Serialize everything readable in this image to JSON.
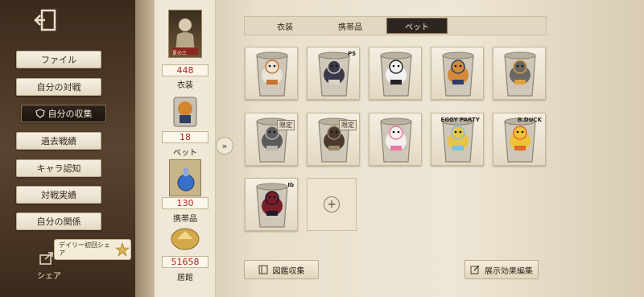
{
  "sidebar": {
    "items": [
      {
        "label": "ファイル"
      },
      {
        "label": "自分の対戦"
      },
      {
        "label": "自分の収集"
      },
      {
        "label": "過去戦績"
      },
      {
        "label": "キャラ認知"
      },
      {
        "label": "対戦実績"
      },
      {
        "label": "自分の関係"
      }
    ],
    "share_banner": "デイリー初回シェア",
    "share_label": "シェア"
  },
  "stats": {
    "costume": {
      "value": "448",
      "label": "衣装",
      "thumb_text": "夏の三"
    },
    "pet": {
      "value": "18",
      "label": "ペット"
    },
    "accessory": {
      "value": "130",
      "label": "携帯品"
    },
    "residence": {
      "value": "51658",
      "label": "居館"
    }
  },
  "tabs": [
    {
      "label": "衣装",
      "active": false
    },
    {
      "label": "携帯品",
      "active": false
    },
    {
      "label": "ペット",
      "active": true
    }
  ],
  "pets": [
    {
      "tag": ""
    },
    {
      "tag": "",
      "corner": "P5"
    },
    {
      "tag": ""
    },
    {
      "tag": ""
    },
    {
      "tag": ""
    },
    {
      "tag": "限定"
    },
    {
      "tag": "限定"
    },
    {
      "tag": ""
    },
    {
      "tag": "",
      "corner": "EGGY PARTY"
    },
    {
      "tag": "",
      "corner": "B.DUCK"
    },
    {
      "tag": "",
      "corner": "Ib"
    }
  ],
  "buttons": {
    "catalog": "図鑑収集",
    "edit_display": "展示効果編集"
  },
  "colors": {
    "accent_red": "#b8261c",
    "active_tab": "#2d2620"
  }
}
